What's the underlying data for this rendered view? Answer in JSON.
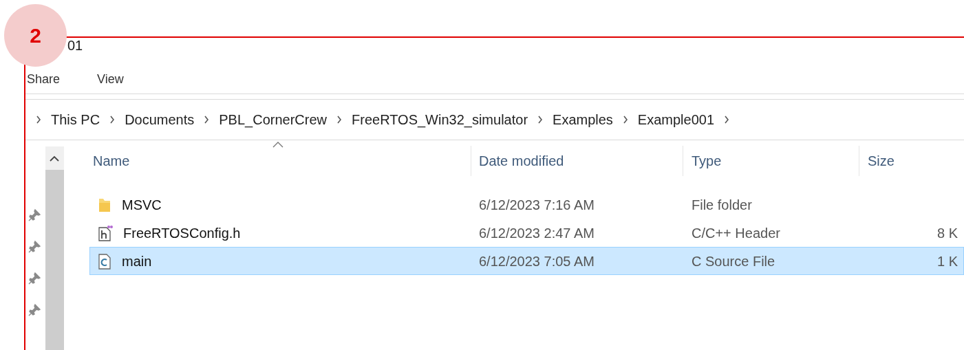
{
  "step_badge": "2",
  "window": {
    "title": "01"
  },
  "ribbon_tabs": [
    {
      "label": "Share"
    },
    {
      "label": "View"
    }
  ],
  "address_bar": {
    "crumbs": [
      "This PC",
      "Documents",
      "PBL_CornerCrew",
      "FreeRTOS_Win32_simulator",
      "Examples",
      "Example001"
    ]
  },
  "file_list": {
    "columns": [
      {
        "label": "Name",
        "sorted": true
      },
      {
        "label": "Date modified",
        "sorted": false
      },
      {
        "label": "Type",
        "sorted": false
      },
      {
        "label": "Size",
        "sorted": false
      }
    ],
    "rows": [
      {
        "kind": "folder",
        "name": "MSVC",
        "date": "6/12/2023 7:16 AM",
        "type": "File folder",
        "selected": false
      },
      {
        "kind": "header",
        "name": "FreeRTOSConfig.h",
        "date": "6/12/2023 2:47 AM",
        "type": "C/C++ Header",
        "size": "8 K",
        "selected": false
      },
      {
        "kind": "c_source",
        "name": "main",
        "date": "6/12/2023 7:05 AM",
        "type": "C Source File",
        "size": "1 K",
        "selected": true
      }
    ]
  }
}
